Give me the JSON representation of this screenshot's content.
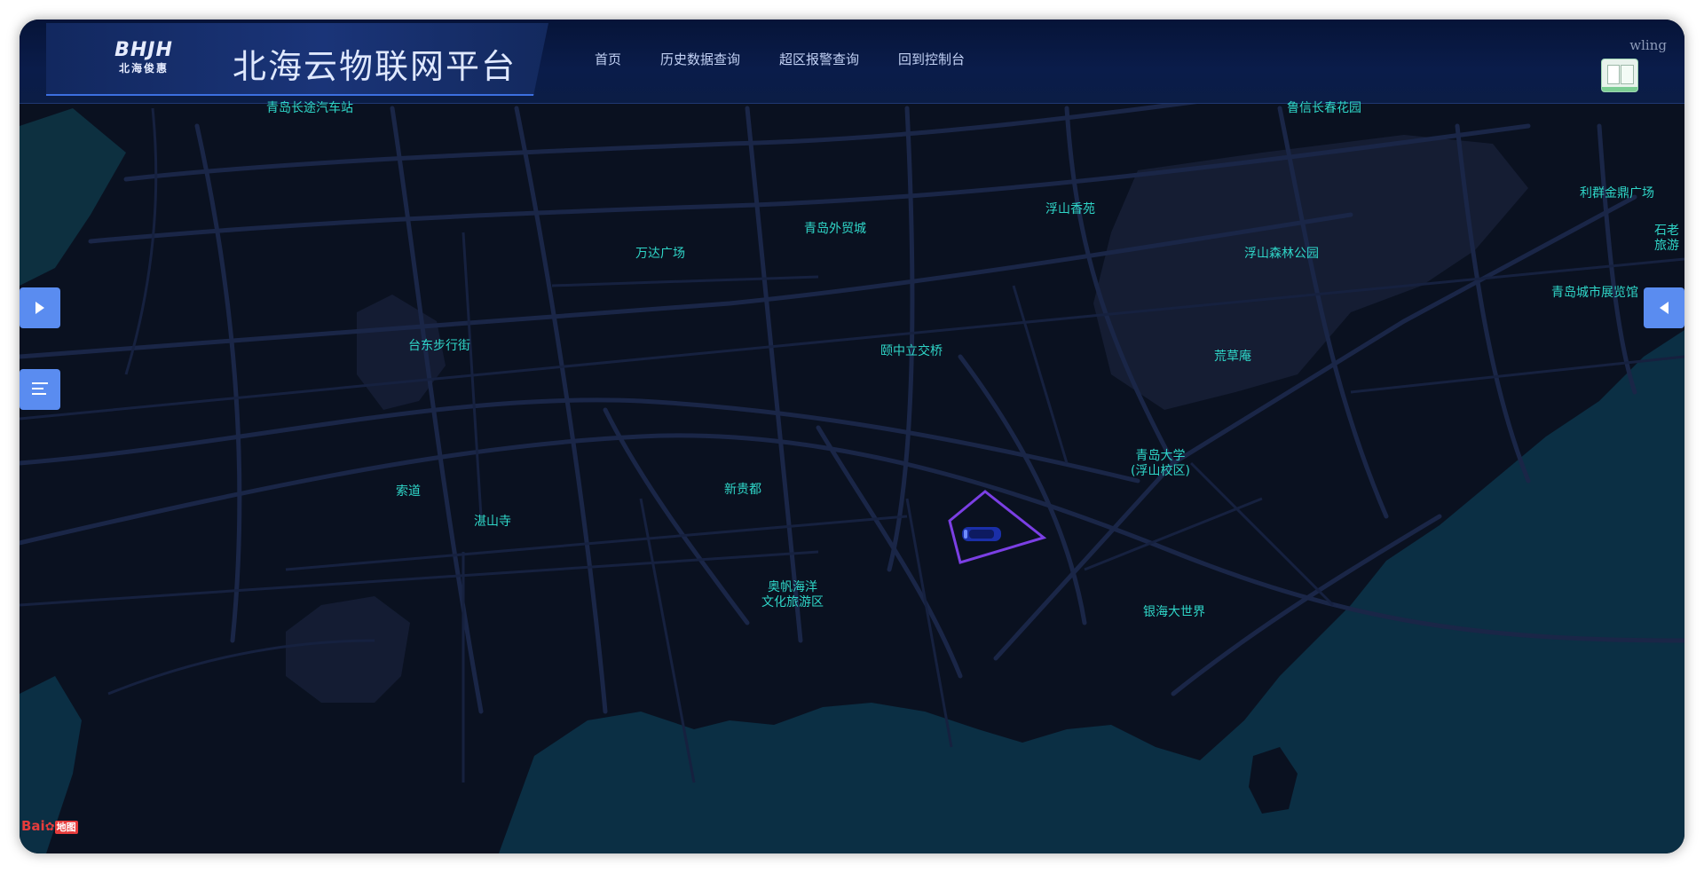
{
  "header": {
    "logo_mark": "BHJH",
    "logo_sub": "北海俊惠",
    "title": "北海云物联网平台",
    "user": "wling"
  },
  "nav": [
    "首页",
    "历史数据查询",
    "超区报警查询",
    "回到控制台"
  ],
  "map": {
    "poi": [
      {
        "name": "青岛长途汽车站"
      },
      {
        "name": "鲁信长春花园"
      },
      {
        "name": "利群金鼎广场"
      },
      {
        "name": "石老\n旅游"
      },
      {
        "name": "浮山香苑"
      },
      {
        "name": "浮山森林公园"
      },
      {
        "name": "青岛外贸城"
      },
      {
        "name": "万达广场"
      },
      {
        "name": "青岛城市展览馆"
      },
      {
        "name": "台东步行街"
      },
      {
        "name": "颐中立交桥"
      },
      {
        "name": "荒草庵"
      },
      {
        "name": "青岛大学\n(浮山校区)"
      },
      {
        "name": "新贵都"
      },
      {
        "name": "索道"
      },
      {
        "name": "湛山寺"
      },
      {
        "name": "奥帆海洋\n文化旅游区"
      },
      {
        "name": "银海大世界"
      }
    ],
    "geofence_color": "#7b3fe4",
    "vehicle_icon": "car-icon",
    "attribution": {
      "brand": "Bai",
      "suffix": "地图"
    }
  },
  "icons": {
    "expand_left": "triangle-right-icon",
    "expand_right": "triangle-left-icon",
    "menu": "list-icon"
  },
  "colors": {
    "poi_label": "#2fd6c8",
    "side_button": "#5a8cf0",
    "land": "#0a1120",
    "water": "#06283a"
  }
}
